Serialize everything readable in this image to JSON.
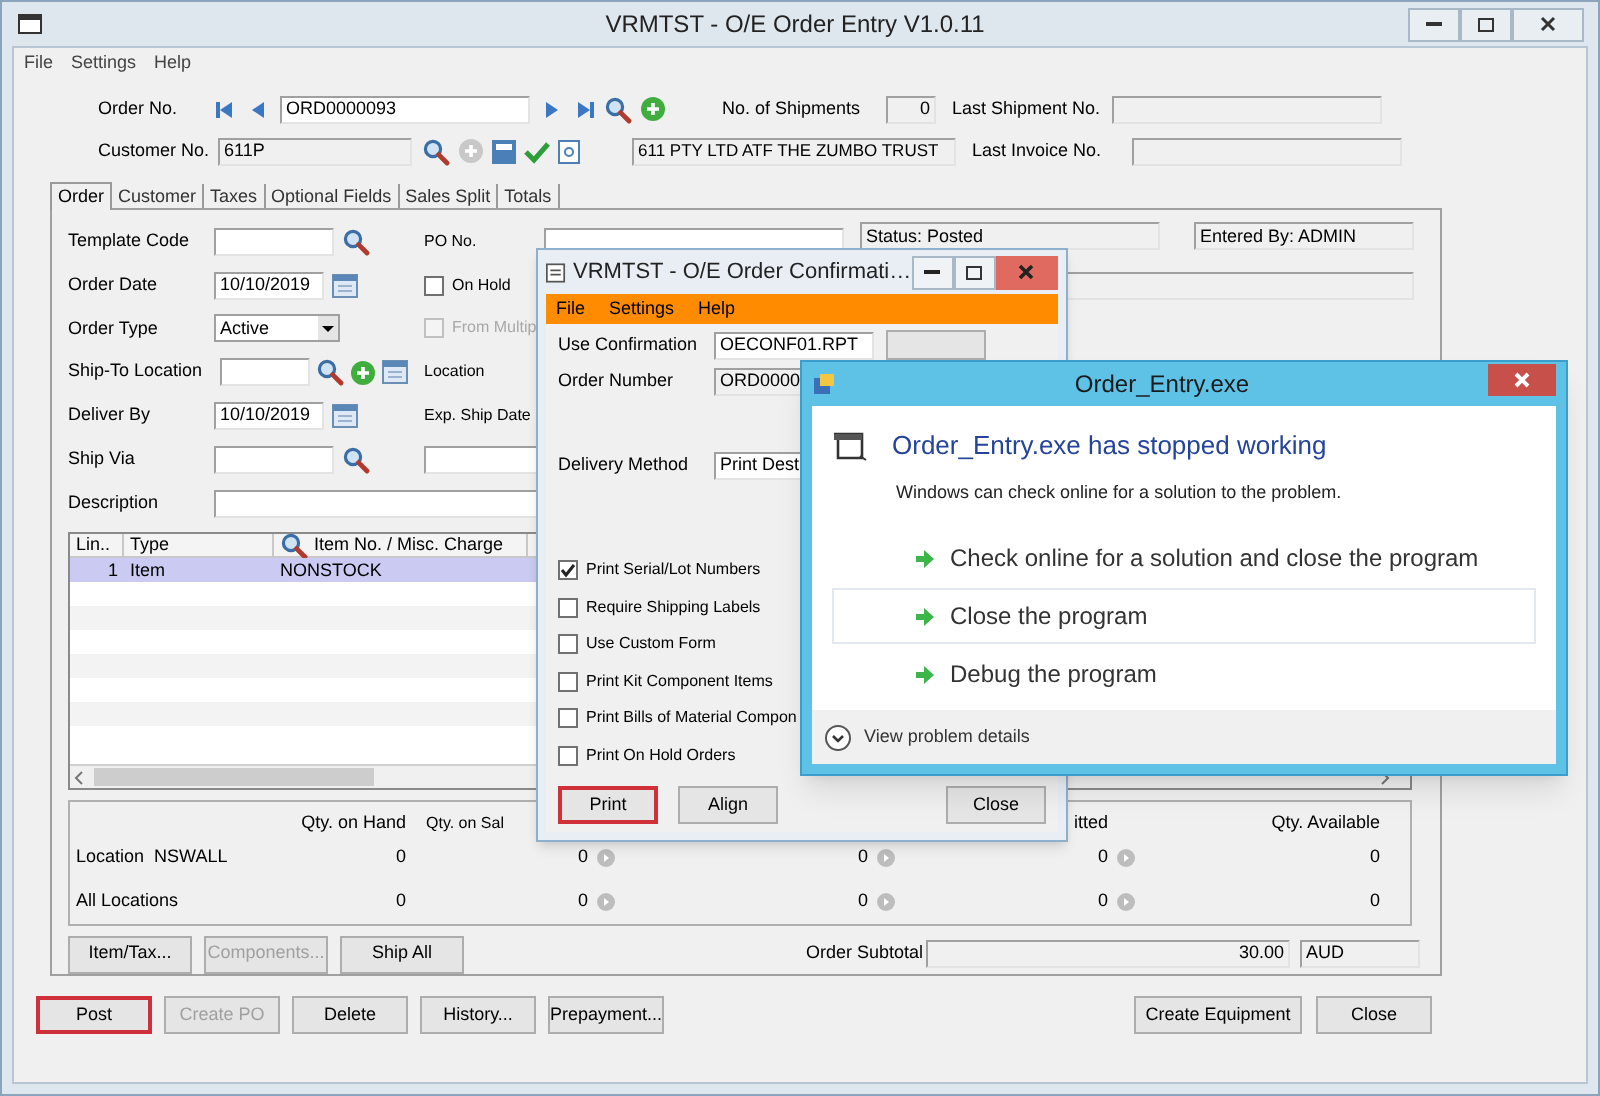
{
  "main_window": {
    "title": "VRMTST - O/E Order Entry V1.0.11",
    "menu": [
      "File",
      "Settings",
      "Help"
    ],
    "header": {
      "order_no": {
        "label": "Order No.",
        "value": "ORD0000093"
      },
      "no_of_shipments": {
        "label": "No. of Shipments",
        "value": "0"
      },
      "last_shipment_no": {
        "label": "Last Shipment No."
      },
      "customer_no": {
        "label": "Customer No.",
        "value": "611P"
      },
      "customer_name": {
        "value": "611 PTY LTD ATF THE ZUMBO TRUST"
      },
      "last_invoice_no": {
        "label": "Last Invoice No."
      }
    },
    "tabs": [
      {
        "label": "Order",
        "selected": true
      },
      {
        "label": "Customer",
        "selected": false
      },
      {
        "label": "Taxes",
        "selected": false
      },
      {
        "label": "Optional Fields",
        "selected": false
      },
      {
        "label": "Sales Split",
        "selected": false
      },
      {
        "label": "Totals",
        "selected": false
      }
    ],
    "form_rows": [
      {
        "left": {
          "label": "Template Code",
          "kind": "lookup"
        },
        "right": {
          "label": "PO No.",
          "kind": "text"
        }
      },
      {
        "left": {
          "label": "Order Date",
          "kind": "date",
          "value": "10/10/2019"
        },
        "right": {
          "label": "On Hold",
          "kind": "checkbox",
          "checked": false,
          "disabled": false
        }
      },
      {
        "left": {
          "label": "Order Type",
          "kind": "select",
          "value": "Active"
        },
        "right": {
          "label": "From Multip",
          "kind": "checkbox",
          "checked": false,
          "disabled": true
        }
      },
      {
        "left": {
          "label": "Ship-To Location",
          "kind": "lookup_add"
        },
        "right": {
          "label": "Location",
          "kind": "label"
        }
      },
      {
        "left": {
          "label": "Deliver By",
          "kind": "date",
          "value": "10/10/2019"
        },
        "right": {
          "label": "Exp. Ship Date",
          "kind": "label"
        }
      },
      {
        "left": {
          "label": "Ship Via",
          "kind": "lookup"
        },
        "right": {
          "kind": "field"
        }
      },
      {
        "left": {
          "label": "Description",
          "kind": "wide"
        }
      }
    ],
    "status": {
      "status": "Status: Posted",
      "entered_by": "Entered By: ADMIN"
    },
    "grid": {
      "columns": [
        "Lin..",
        "Type",
        "Item No. / Misc. Charge"
      ],
      "rows": [
        {
          "cells": [
            "1",
            "Item",
            "NONSTOCK"
          ],
          "selected": true
        }
      ]
    },
    "quantities": {
      "columns": [
        {
          "header": "Qty. on Hand",
          "drilldown": false
        },
        {
          "header": "Qty. on Sal",
          "drilldown": true
        },
        {
          "drilldown": true
        },
        {
          "header": "itted",
          "drilldown": true
        },
        {
          "header": "Qty. Available",
          "drilldown": false
        }
      ],
      "rows": [
        {
          "label": "Location  NSWALL",
          "values": [
            "0",
            "0",
            "0",
            "0",
            "0"
          ]
        },
        {
          "label": "All Locations",
          "values": [
            "0",
            "0",
            "0",
            "0",
            "0"
          ]
        }
      ]
    },
    "line_buttons": [
      {
        "label": "Item/Tax...",
        "disabled": false
      },
      {
        "label": "Components...",
        "disabled": true
      },
      {
        "label": "Ship All",
        "disabled": false
      }
    ],
    "subtotal": {
      "label": "Order Subtotal",
      "value": "30.00",
      "currency": "AUD"
    },
    "bottom_buttons_left": [
      {
        "label": "Post",
        "disabled": false,
        "highlighted": true
      },
      {
        "label": "Create PO",
        "disabled": true,
        "highlighted": false
      },
      {
        "label": "Delete",
        "disabled": false,
        "highlighted": false
      },
      {
        "label": "History...",
        "disabled": false,
        "highlighted": false
      },
      {
        "label": "Prepayment...",
        "disabled": false,
        "highlighted": false
      }
    ],
    "bottom_buttons_right": [
      {
        "label": "Create Equipment",
        "disabled": false,
        "highlighted": false
      },
      {
        "label": "Close",
        "disabled": false,
        "highlighted": false
      }
    ]
  },
  "confirmation_window": {
    "title": "VRMTST - O/E Order Confirmati…",
    "menu": [
      "File",
      "Settings",
      "Help"
    ],
    "use_confirmation": {
      "label": "Use Confirmation",
      "value": "OECONF01.RPT"
    },
    "order_number": {
      "label": "Order Number",
      "value": "ORD0000"
    },
    "delivery_method": {
      "label": "Delivery Method",
      "value": "Print Dest"
    },
    "options": [
      {
        "label": "Print Serial/Lot Numbers",
        "checked": true
      },
      {
        "label": "Require Shipping Labels",
        "checked": false
      },
      {
        "label": "Use Custom Form",
        "checked": false
      },
      {
        "label": "Print Kit Component Items",
        "checked": false
      },
      {
        "label": "Print Bills of Material Compon",
        "checked": false
      },
      {
        "label": "Print On Hold Orders",
        "checked": false
      }
    ],
    "buttons": [
      {
        "label": "Print",
        "highlighted": true
      },
      {
        "label": "Align",
        "highlighted": false
      },
      {
        "label": "Close",
        "highlighted": false
      }
    ]
  },
  "error_dialog": {
    "title": "Order_Entry.exe",
    "heading": "Order_Entry.exe has stopped working",
    "message": "Windows can check online for a solution to the problem.",
    "options": [
      {
        "label": "Check online for a solution and close the program",
        "selected": false
      },
      {
        "label": "Close the program",
        "selected": true
      },
      {
        "label": "Debug the program",
        "selected": false
      }
    ],
    "details": "View problem details"
  }
}
